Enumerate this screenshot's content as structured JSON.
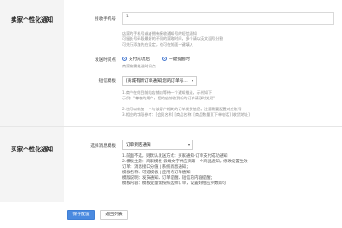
{
  "buyer_section": {
    "title": "卖家个性化通知",
    "phone": {
      "label": "接收手机号",
      "value": "1",
      "hints": [
        "店家的手机号或者拥有接收通知号的短信通知",
        "可留长号码段最好的不同的家政时间，多个请以英文逗号分割",
        "可先行添加先在设定，也可在前面一键填入"
      ]
    },
    "send_time": {
      "label": "发送时间点",
      "options": [
        "支付成功后",
        "一键提醒时"
      ],
      "hint": "商家按需推送时间点"
    },
    "sms_template": {
      "label": "短信模板",
      "selected": "[商城有新订单通知]您的订单号...",
      "lines": [
        "1.商户在你目前的店铺内等待一个通知推送，示例如下:",
        "示例：\"尊敬的用户，您的店铺收到新的订单请及时处理\"",
        "",
        "2.也可以新加一个与该客户相关的订单发货信息，注意需要配置对应账号",
        "3.相应的字段参考：[会员名称] [商品名称] [商品数量] [下单电话] [收货地址]"
      ]
    }
  },
  "seller_section": {
    "title": "买家个性化通知",
    "template": {
      "label": "选择消息模板",
      "selected": "订单到店通知",
      "lines": [
        "1.前面不选，则默认发送方式：买家通知-订单支付成功通知",
        "2.模板主题：商家模板-云端文字供应商第一个商品通知，修改设置生效",
        "订单：消息接口分值 | 系统消息通知；",
        "模板名称：可选模板 | 应用的订单通知",
        "模版说明：发货通知、订单提醒、短信的内容提醒；",
        "模板内容：模板变量需按照选择订单，设置好相应参数即可"
      ]
    }
  },
  "actions": {
    "save": "保存配置",
    "back": "返回列表"
  }
}
